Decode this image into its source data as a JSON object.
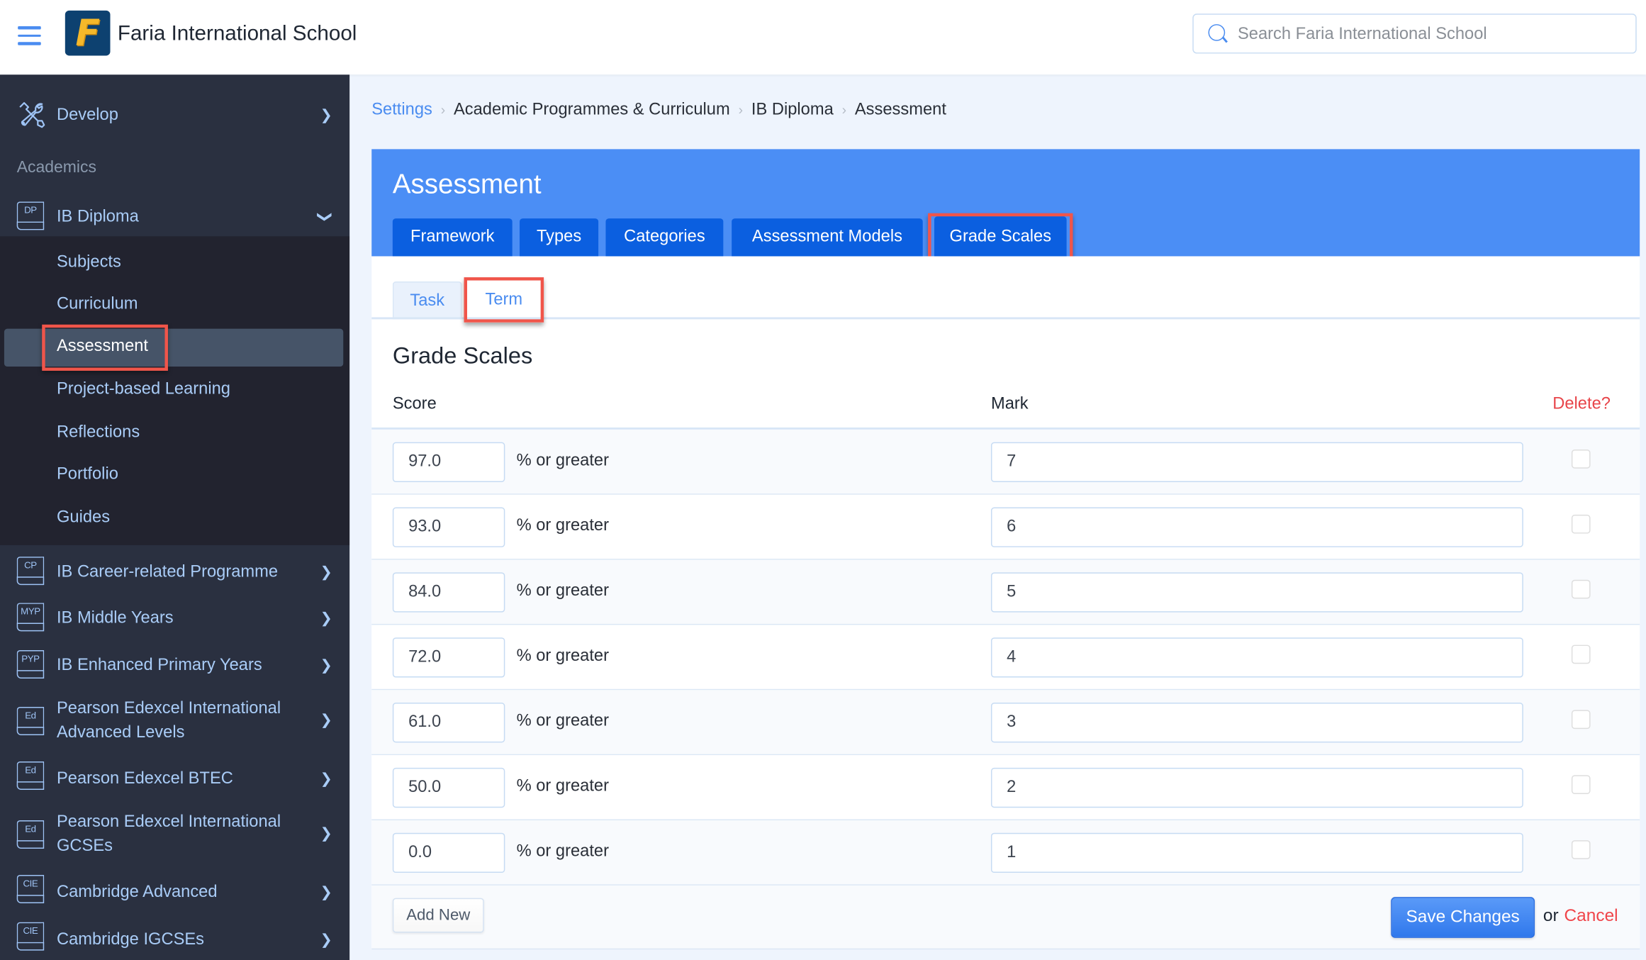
{
  "topbar": {
    "school_name": "Faria International School",
    "logo_letter": "F",
    "search_placeholder": "Search Faria International School",
    "search_value": ""
  },
  "sidebar": {
    "develop": "Develop",
    "section_academics": "Academics",
    "ib_diploma": {
      "abbr": "DP",
      "label": "IB Diploma"
    },
    "submenu": [
      "Subjects",
      "Curriculum",
      "Assessment",
      "Project-based Learning",
      "Reflections",
      "Portfolio",
      "Guides"
    ],
    "active_submenu": "Assessment",
    "programmes": [
      {
        "abbr": "CP",
        "label": "IB Career-related Programme"
      },
      {
        "abbr": "MYP",
        "label": "IB Middle Years"
      },
      {
        "abbr": "PYP",
        "label": "IB Enhanced Primary Years"
      },
      {
        "abbr": "Ed",
        "label": "Pearson Edexcel International Advanced Levels"
      },
      {
        "abbr": "Ed",
        "label": "Pearson Edexcel BTEC"
      },
      {
        "abbr": "Ed",
        "label": "Pearson Edexcel International GCSEs"
      },
      {
        "abbr": "CIE",
        "label": "Cambridge Advanced"
      },
      {
        "abbr": "CIE",
        "label": "Cambridge IGCSEs"
      }
    ]
  },
  "breadcrumb": [
    "Settings",
    "Academic Programmes & Curriculum",
    "IB Diploma",
    "Assessment"
  ],
  "panel": {
    "title": "Assessment",
    "tabs": [
      "Framework",
      "Types",
      "Categories",
      "Assessment Models",
      "Grade Scales"
    ],
    "active_tab": "Grade Scales",
    "subtabs": [
      "Task",
      "Term"
    ],
    "active_subtab": "Term"
  },
  "grade_scales": {
    "title": "Grade Scales",
    "col_score": "Score",
    "col_mark": "Mark",
    "col_delete": "Delete?",
    "suffix": "% or greater",
    "rows": [
      {
        "score": "97.0",
        "mark": "7",
        "delete": false
      },
      {
        "score": "93.0",
        "mark": "6",
        "delete": false
      },
      {
        "score": "84.0",
        "mark": "5",
        "delete": false
      },
      {
        "score": "72.0",
        "mark": "4",
        "delete": false
      },
      {
        "score": "61.0",
        "mark": "3",
        "delete": false
      },
      {
        "score": "50.0",
        "mark": "2",
        "delete": false
      },
      {
        "score": "0.0",
        "mark": "1",
        "delete": false
      }
    ]
  },
  "actions": {
    "add_new": "Add New",
    "save": "Save Changes",
    "or": "or",
    "cancel": "Cancel"
  },
  "colors": {
    "accent": "#4b8ef5",
    "tab_active": "#0b5fe0",
    "sidebar_bg": "#2a3040",
    "highlight": "#f0554a",
    "danger": "#e8454a"
  }
}
